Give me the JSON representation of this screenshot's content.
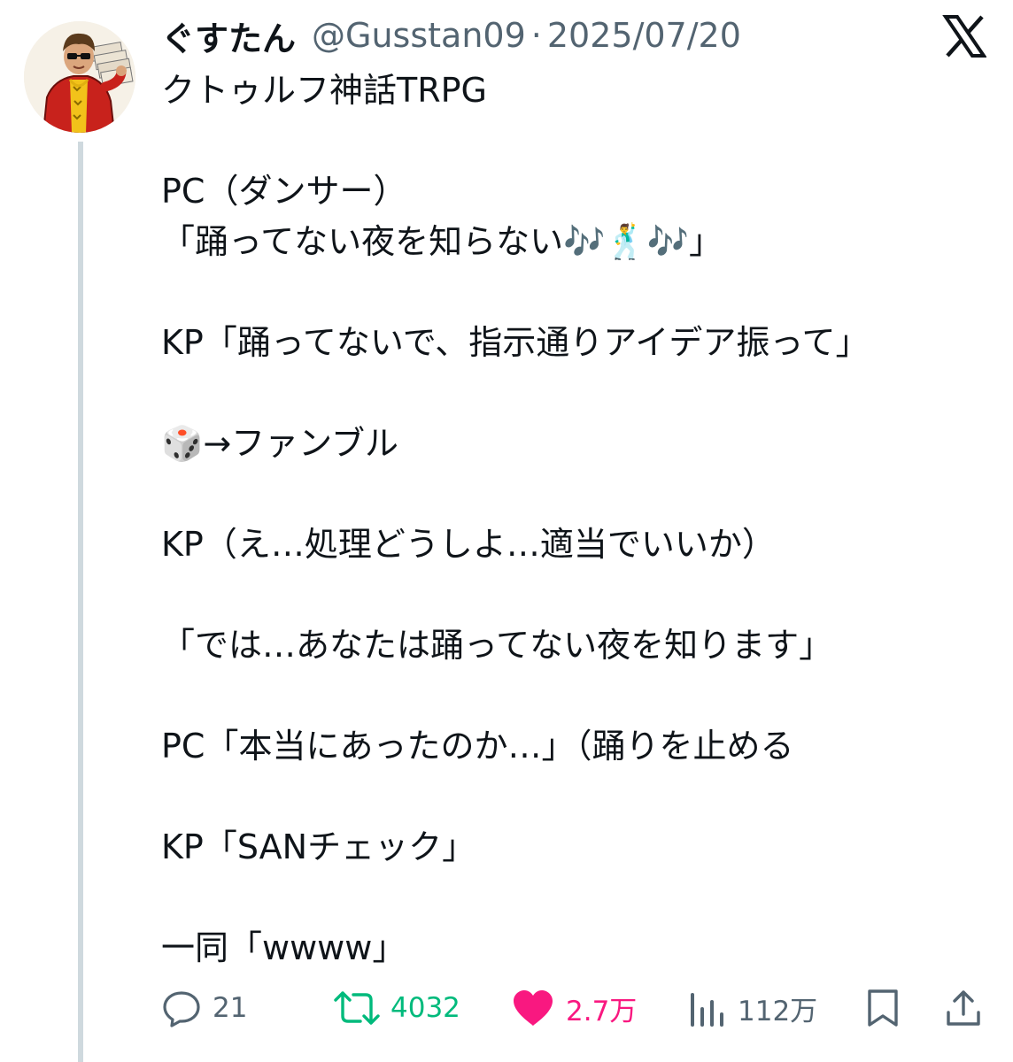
{
  "author": {
    "display_name": "ぐすたん",
    "handle": "@Gusstan09",
    "separator": "·",
    "date": "2025/07/20"
  },
  "brand_icon": "x-logo-icon",
  "tweet": {
    "text": "クトゥルフ神話TRPG\n\nPC（ダンサー）\n「踊ってない夜を知らない🎶🕺🎶」\n\nKP「踊ってないで、指示通りアイデア振って」\n\n🎲→ファンブル\n\nKP（え…処理どうしよ…適当でいいか）\n\n「では…あなたは踊ってない夜を知ります」\n\nPC「本当にあったのか…」（踊りを止める\n\nKP「SANチェック」\n\n一同「wwww」"
  },
  "actions": {
    "reply": {
      "icon": "reply-icon",
      "count": "21"
    },
    "retweet": {
      "icon": "retweet-icon",
      "count": "4032"
    },
    "like": {
      "icon": "heart-icon",
      "count": "2.7万"
    },
    "views": {
      "icon": "views-icon",
      "count": "112万"
    },
    "bookmark": {
      "icon": "bookmark-icon"
    },
    "share": {
      "icon": "share-icon"
    }
  },
  "colors": {
    "text": "#0f1419",
    "secondary": "#536471",
    "retweet": "#00ba7c",
    "like": "#f91880",
    "thread_line": "#cfd9de"
  }
}
